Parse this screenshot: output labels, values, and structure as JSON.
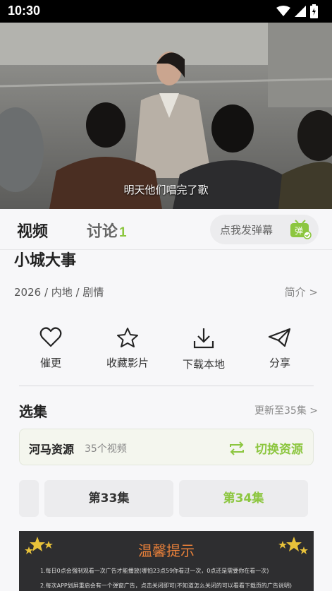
{
  "status_bar": {
    "time": "10:30"
  },
  "video": {
    "subtitle": "明天他们唱完了歌"
  },
  "tabs": [
    {
      "label": "视频"
    },
    {
      "label": "讨论",
      "count": "1"
    }
  ],
  "danmu": {
    "placeholder": "点我发弹幕",
    "icon_text": "弹"
  },
  "show": {
    "title": "小城大事",
    "meta": "2026 / 内地 / 剧情",
    "intro_link": "简介 >"
  },
  "actions": [
    {
      "label": "催更",
      "icon": "heart-icon"
    },
    {
      "label": "收藏影片",
      "icon": "star-icon"
    },
    {
      "label": "下载本地",
      "icon": "download-icon"
    },
    {
      "label": "分享",
      "icon": "paper-plane-icon"
    }
  ],
  "episodes": {
    "heading": "选集",
    "update_link": "更新至35集 >",
    "source_name": "河马资源",
    "source_count": "35个视频",
    "switch_label": "切换资源",
    "items": [
      "第33集",
      "第34集"
    ]
  },
  "notice": {
    "title": "温馨提示",
    "line1": "1.每日0点会强制观看一次广告才能播放(哪怕23点59你看过一次，0点还是需要你在看一次)",
    "line2": "2.每次APP划屏重启会有一个弹窗广告，点击关闭即可(不知道怎么关闭的可以看看下载页的广告说明)"
  },
  "colors": {
    "accent": "#8cc63f",
    "notice_title": "#e8803a"
  }
}
